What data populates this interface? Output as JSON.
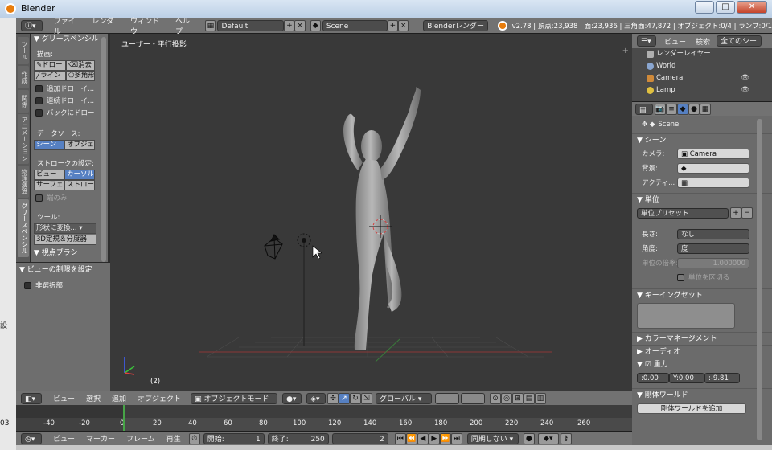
{
  "window": {
    "title": "Blender",
    "minimize": "─",
    "maximize": "□",
    "close": "✕"
  },
  "desktop": {
    "label1": "設",
    "label2": "03"
  },
  "info": {
    "menus": [
      "ファイル",
      "レンダー",
      "ウィンドウ",
      "ヘルプ"
    ],
    "layout": "Default",
    "scene": "Scene",
    "engine": "Blenderレンダー",
    "stats": "v2.78 | 頂点:23,938 | 面:23,936 | 三角面:47,872 | オブジェクト:0/4 | ランプ:0/1"
  },
  "tools": {
    "tabs": [
      "ツール",
      "作成",
      "関係",
      "アニメーション",
      "物理演算",
      "グリースペンシル"
    ],
    "panel_title": "グリースペンシル",
    "draw_label": "描画:",
    "draw_buttons": [
      "ドロー",
      "消去",
      "ライン",
      "多角形"
    ],
    "checkboxes": [
      "追加ドローイ...",
      "連続ドローイ...",
      "バックにドロー"
    ],
    "source_label": "データソース:",
    "source_buttons": [
      "シーン",
      "オブジェ"
    ],
    "stroke_label": "ストロークの設定:",
    "stroke_row1": [
      "ビュー",
      "カーソル"
    ],
    "stroke_row2": [
      "サーフェ",
      "ストロー"
    ],
    "only_ends": "端のみ",
    "tool_label": "ツール:",
    "shape_convert": "形状に変換...",
    "measure": "3D定規＆分度器",
    "next_panel": "視点ブラシ"
  },
  "view_panel": {
    "title": "ビューの制限を設定",
    "checkbox": "非選択部"
  },
  "viewport": {
    "title": "ユーザー・平行投影",
    "frame": "(2)",
    "plus": "+"
  },
  "view_header": {
    "menus": [
      "ビュー",
      "選択",
      "追加",
      "オブジェクト"
    ],
    "mode": "オブジェクトモード",
    "orientation": "グローバル"
  },
  "timeline": {
    "ticks": [
      "-40",
      "-20",
      "0",
      "20",
      "40",
      "60",
      "80",
      "100",
      "120",
      "140",
      "160",
      "180",
      "200",
      "220",
      "240",
      "260"
    ],
    "current_frame": 2,
    "menus": [
      "ビュー",
      "マーカー",
      "フレーム",
      "再生"
    ],
    "start_label": "開始:",
    "start": "1",
    "end_label": "終了:",
    "end": "250",
    "frame": "2",
    "sync": "同期しない"
  },
  "outliner": {
    "menus": [
      "ビュー",
      "検索"
    ],
    "filter": "全てのシーン",
    "rows": [
      {
        "label": "レンダーレイヤー",
        "color": "#b0b0b0"
      },
      {
        "label": "World",
        "color": "#8aa6d0"
      },
      {
        "label": "Camera",
        "color": "#d08a3a"
      },
      {
        "label": "Lamp",
        "color": "#e0c040"
      }
    ]
  },
  "properties": {
    "context": "Scene",
    "scene_section": "シーン",
    "camera_label": "カメラ:",
    "camera": "Camera",
    "background_label": "背景:",
    "active_label": "アクティ...",
    "units_section": "単位",
    "unit_preset": "単位プリセット",
    "length_label": "長さ:",
    "length": "なし",
    "angle_label": "角度:",
    "angle": "度",
    "scale_label": "単位の倍率:",
    "scale": "1.000000",
    "separate": "単位を区切る",
    "keying_section": "キーイングセット",
    "color_section": "カラーマネージメント",
    "audio_section": "オーディオ",
    "gravity_section": "重力",
    "gravity": [
      ":0.00",
      "Y:0.00",
      ":-9.81"
    ],
    "rigid_section": "剛体ワールド",
    "rigid_button": "剛体ワールドを追加"
  },
  "colors": {
    "accent": "#5680c2",
    "timeline_cursor": "#47a447",
    "grid_red": "#8a3838",
    "grid_green": "#3a7a3a"
  }
}
